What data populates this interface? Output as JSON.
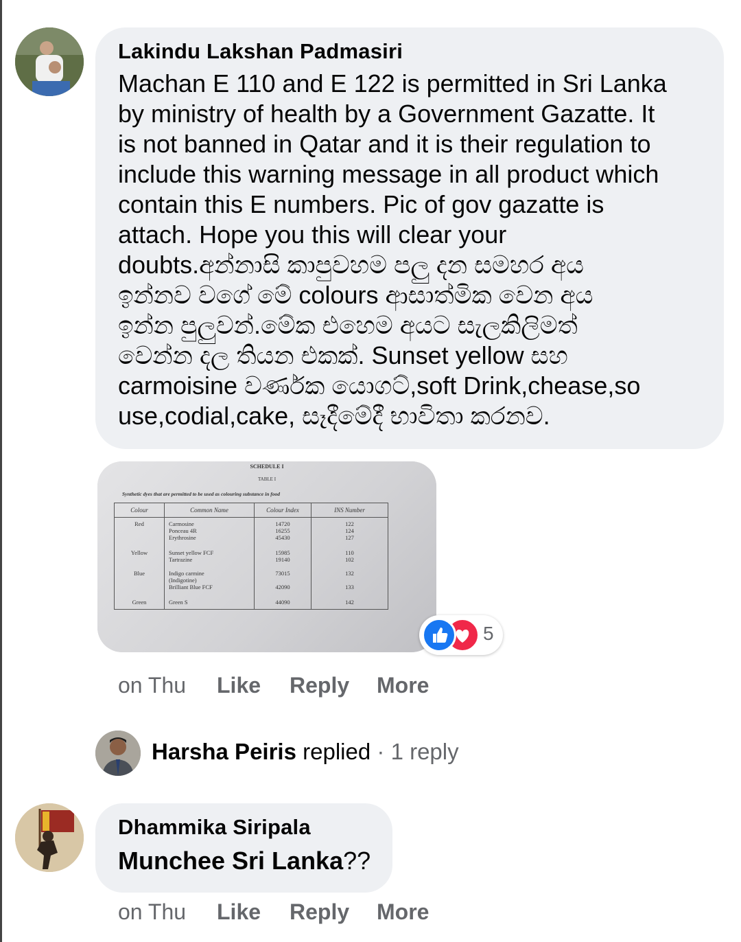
{
  "comment1": {
    "author": "Lakindu Lakshan Padmasiri",
    "lines": [
      "Machan E 110 and E 122 is permitted in Sri Lanka",
      "by ministry of health by a Government Gazatte. It",
      "is not banned in Qatar and it is their regulation to",
      "include this warning message in all product which",
      "contain this E numbers. Pic of gov gazatte is",
      "attach. Hope you this will clear your",
      "doubts.අන්නාසි කාපුවහම පලු දන සමහර අය",
      "ඉන්නව වගේ මේ colours ආසාත්මික වෙන අය",
      "ඉන්න පුලුවන්.මේක එහෙම අයට සැලකිලිමත්",
      "වෙන්න දල තියන එකක්. Sunset yellow සහ",
      "carmoisine වර්ණක යොගට්,soft Drink,chease,so",
      "use,codial,cake, සෑදීමේදී භාවිතා කරනව."
    ],
    "attachment": {
      "schedule": "SCHEDULE I",
      "table_label": "TABLE I",
      "caption": "Synthetic dyes that are permitted to be used as colouring substance in food",
      "headers": [
        "Colour",
        "Common Name",
        "Colour Index",
        "INS Number"
      ],
      "rows": [
        {
          "colour": "Red",
          "names": [
            "Carmosine",
            "Ponceau 4R",
            "Erythrosine"
          ],
          "index": [
            "14720",
            "16255",
            "45430"
          ],
          "ins": [
            "122",
            "124",
            "127"
          ]
        },
        {
          "colour": "Yellow",
          "names": [
            "Sunset yellow FCF",
            "Tartrazine"
          ],
          "index": [
            "15985",
            "19140"
          ],
          "ins": [
            "110",
            "102"
          ]
        },
        {
          "colour": "Blue",
          "names": [
            "Indigo carmine",
            "(Indigotine)",
            "Brilliant Blue FCF"
          ],
          "index": [
            "73015",
            "",
            "42090"
          ],
          "ins": [
            "132",
            "",
            "133"
          ]
        },
        {
          "colour": "Green",
          "names": [
            "Green S"
          ],
          "index": [
            "44090"
          ],
          "ins": [
            "142"
          ]
        }
      ]
    },
    "reaction_count": "5",
    "actions": {
      "time": "on Thu",
      "like": "Like",
      "reply": "Reply",
      "more": "More"
    }
  },
  "reply_summary": {
    "name": "Harsha Peiris",
    "verb": "replied",
    "separator": "·",
    "count": "1 reply"
  },
  "comment2": {
    "author": "Dhammika Siripala",
    "text": "Munchee Sri Lanka",
    "text_suffix": "??",
    "actions": {
      "time": "on Thu",
      "like": "Like",
      "reply": "Reply",
      "more": "More"
    }
  },
  "colors": {
    "bubble": "#eef0f3",
    "meta": "#65676b",
    "like_blue": "#1877f2",
    "love_red": "#f02849"
  }
}
